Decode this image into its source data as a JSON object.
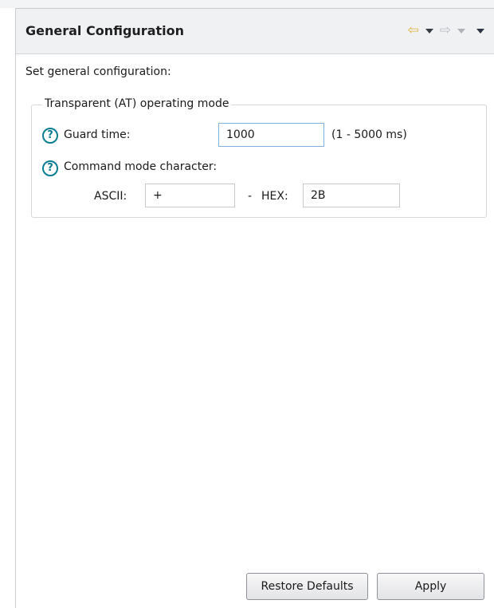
{
  "header": {
    "title": "General Configuration",
    "nav": {
      "back_icon": "back-arrow-icon",
      "forward_icon": "forward-arrow-icon",
      "menu_icon": "view-menu-icon"
    }
  },
  "intro_text": "Set general configuration:",
  "group": {
    "title": "Transparent (AT) operating mode",
    "guard_time": {
      "label": "Guard time:",
      "value": "1000",
      "range": "(1 - 5000 ms)"
    },
    "command_char": {
      "label": "Command mode character:",
      "ascii_label": "ASCII:",
      "ascii_value": "+",
      "separator": "-",
      "hex_label": "HEX:",
      "hex_value": "2B"
    }
  },
  "buttons": {
    "restore_defaults": "Restore Defaults",
    "apply": "Apply"
  },
  "colors": {
    "help_icon": "#0b7d93",
    "back_arrow": "#e0b341",
    "header_bg": "#f0f1f3"
  }
}
